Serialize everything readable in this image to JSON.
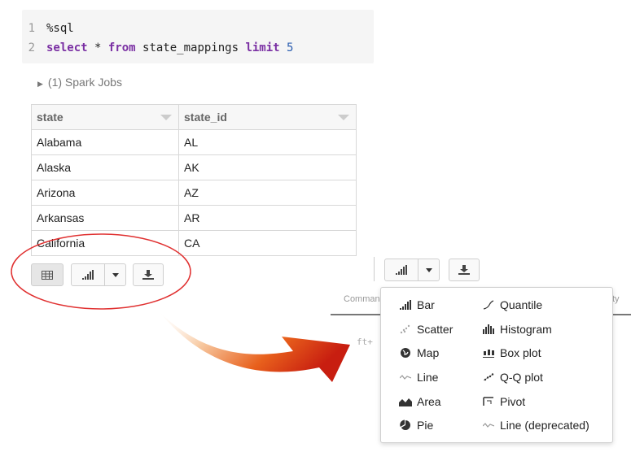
{
  "code_cell": {
    "lines": [
      {
        "n": "1",
        "text": "%sql"
      },
      {
        "n": "2",
        "kw1": "select",
        "mid1": " * ",
        "kw2": "from",
        "mid2": " state_mappings ",
        "kw3": "limit",
        "num": " 5"
      }
    ]
  },
  "spark_jobs": "(1) Spark Jobs",
  "table": {
    "headers": [
      "state",
      "state_id"
    ],
    "rows": [
      [
        "Alabama",
        "AL"
      ],
      [
        "Alaska",
        "AK"
      ],
      [
        "Arizona",
        "AZ"
      ],
      [
        "Arkansas",
        "AR"
      ],
      [
        "California",
        "CA"
      ]
    ]
  },
  "right_panel": {
    "tab_left": "Comman",
    "tab_right": "ty",
    "shortcut_hint": "ft+"
  },
  "plot_menu": {
    "left": [
      "Bar",
      "Scatter",
      "Map",
      "Line",
      "Area",
      "Pie"
    ],
    "right": [
      "Quantile",
      "Histogram",
      "Box plot",
      "Q-Q plot",
      "Pivot",
      "Line (deprecated)"
    ]
  },
  "colors": {
    "annotation_red": "#e03030",
    "arrow_dark": "#c81e10",
    "arrow_light": "#f7c8a0"
  }
}
